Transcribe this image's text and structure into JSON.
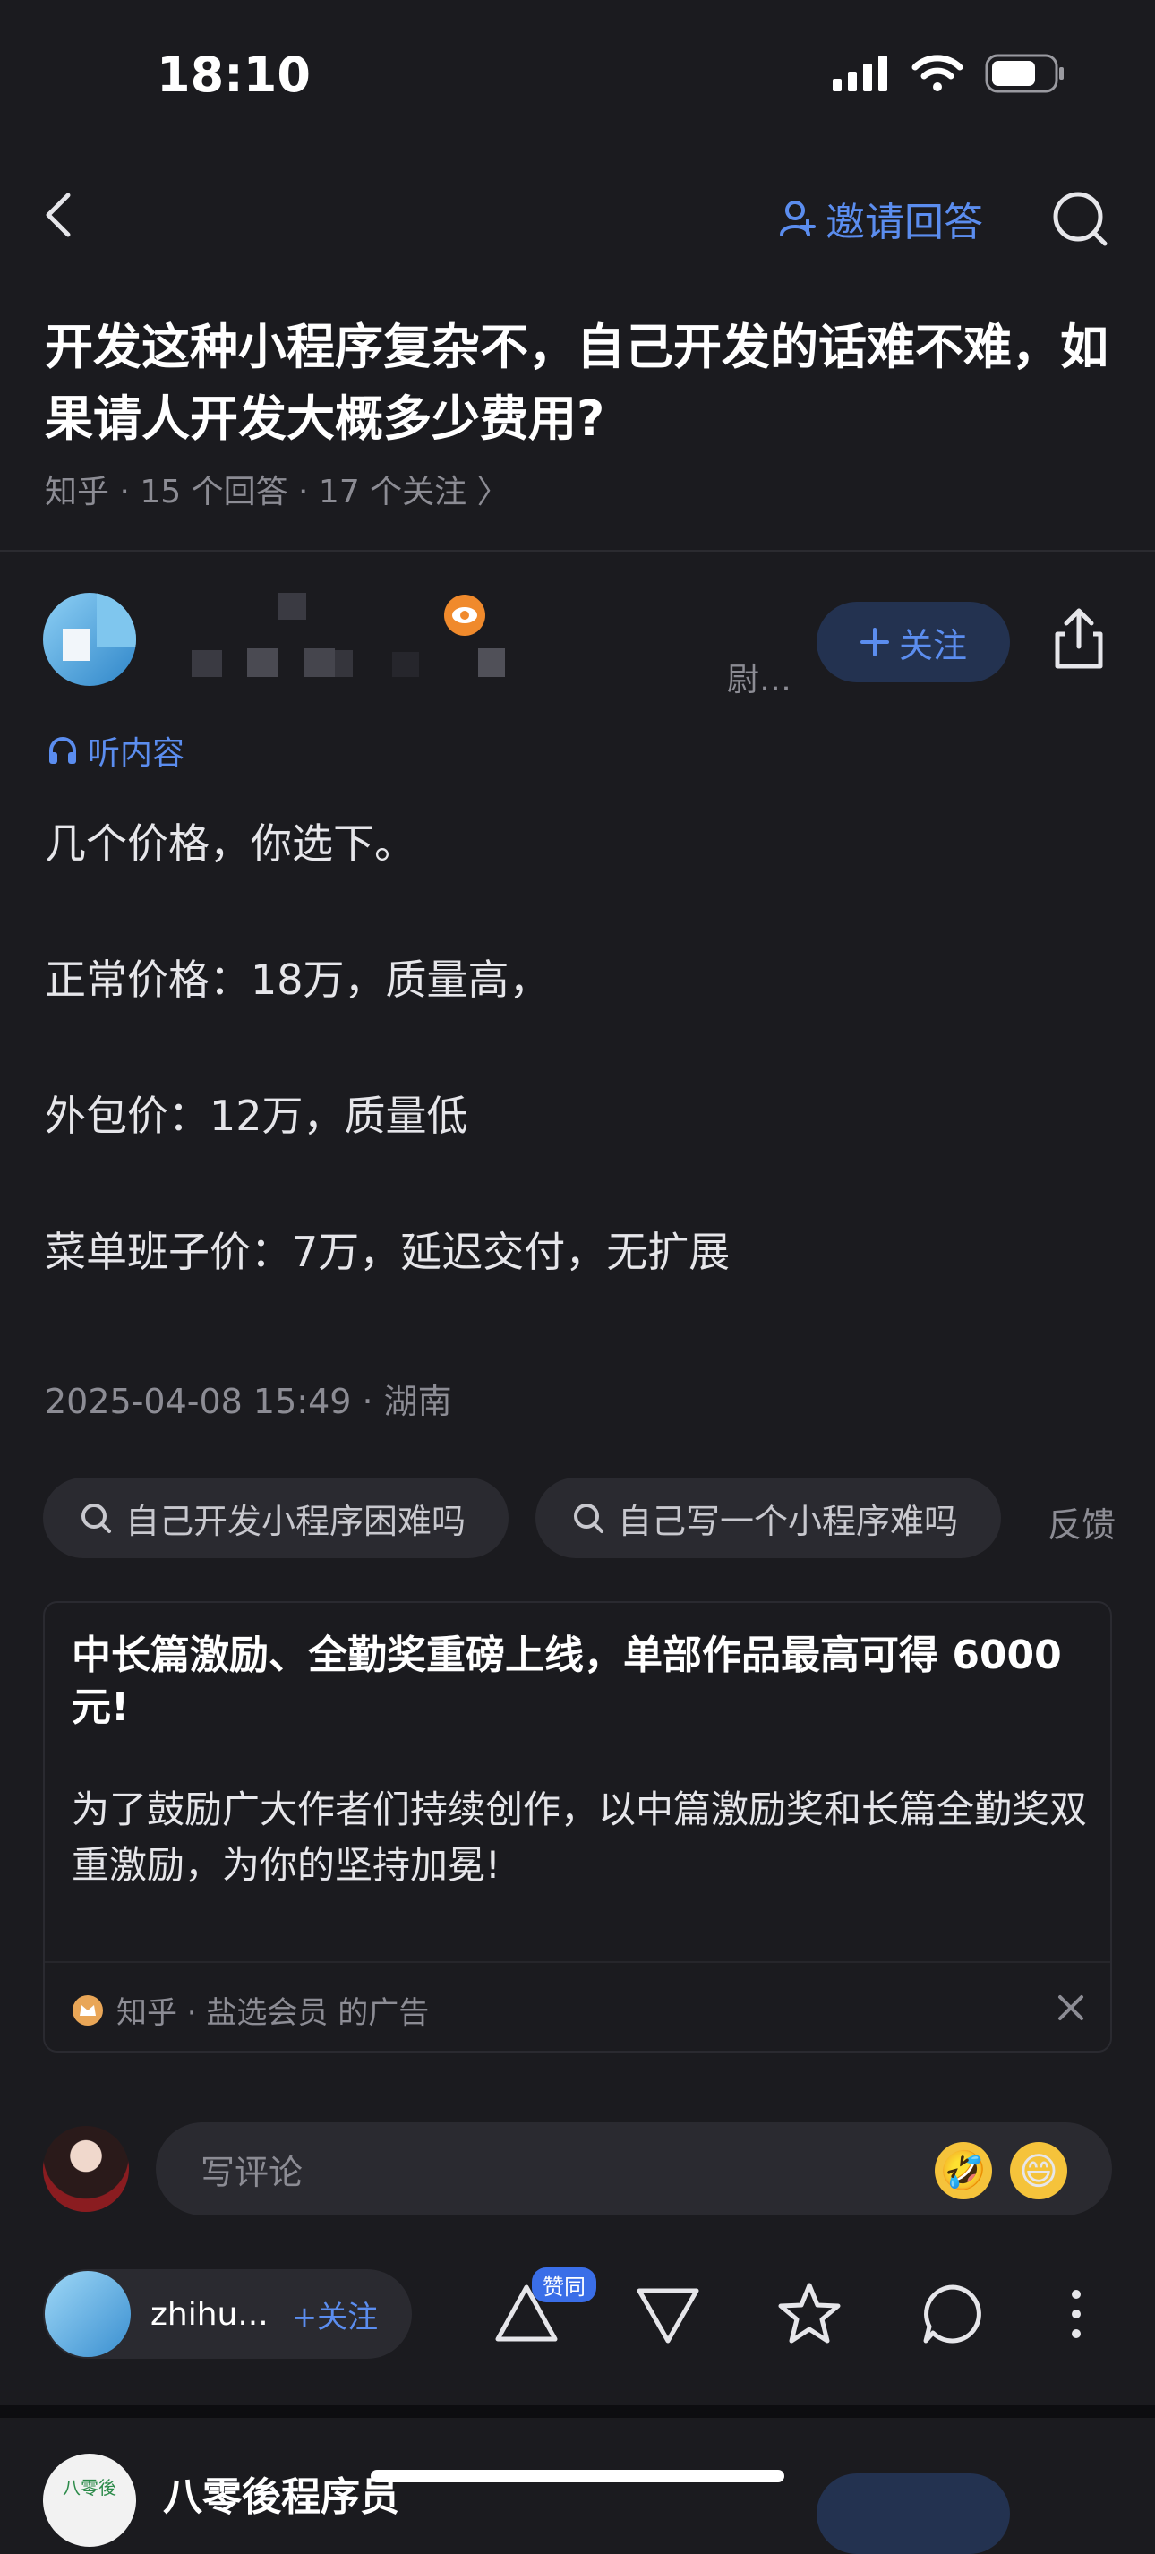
{
  "status_bar": {
    "time": "18:10"
  },
  "nav": {
    "invite_label": "邀请回答"
  },
  "question": {
    "title": "开发这种小程序复杂不，自己开发的话难不难，如果请人开发大概多少费用?",
    "meta": "知乎 · 15 个回答 · 17 个关注 〉"
  },
  "author": {
    "tag": "尉…",
    "follow_label": "关注"
  },
  "answer": {
    "listen_label": "听内容",
    "lines": [
      "几个价格，你选下。",
      "正常价格：18万，质量高，",
      "外包价：12万，质量低",
      "菜单班子价：7万，延迟交付，无扩展"
    ],
    "date": "2025-04-08 15:49 · 湖南"
  },
  "related": {
    "chips": [
      "自己开发小程序困难吗",
      "自己写一个小程序难吗"
    ],
    "feedback": "反馈"
  },
  "ad": {
    "title": "中长篇激励、全勤奖重磅上线，单部作品最高可得 6000 元!",
    "desc": "为了鼓励广大作者们持续创作，以中篇激励奖和长篇全勤奖双重激励，为你的坚持加冕!",
    "footer": "知乎 · 盐选会员 的广告"
  },
  "comment": {
    "placeholder": "写评论",
    "emojis": [
      "🤣",
      "😄"
    ]
  },
  "bottom_bar": {
    "user_name": "zhihu...",
    "follow_label": "+关注",
    "upvote_badge": "赞同"
  },
  "next_answer": {
    "author_name": "八零後程序员",
    "avatar_text": "八零後"
  },
  "icons": [
    "back-icon",
    "invite-person-icon",
    "search-icon",
    "eye-badge-icon",
    "plus-icon",
    "share-icon",
    "headphones-icon",
    "close-icon",
    "upvote-icon",
    "downvote-icon",
    "star-icon",
    "comment-icon",
    "more-icon"
  ],
  "colors": {
    "accent": "#5b8def",
    "background": "#1b1b1f"
  }
}
